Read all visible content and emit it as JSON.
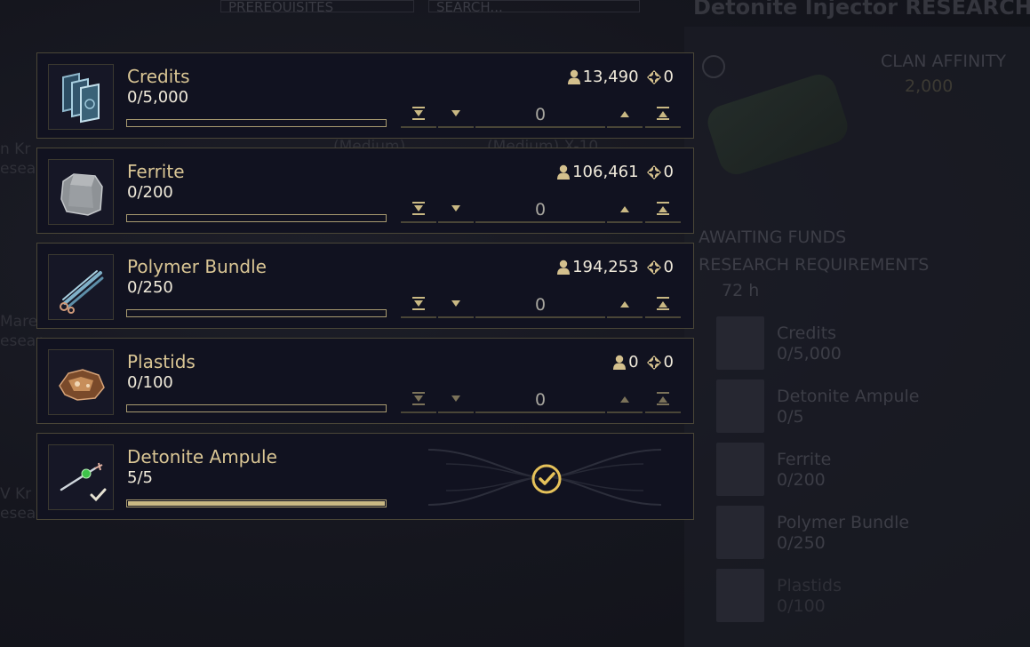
{
  "background": {
    "prereq_label": "PREREQUISITES",
    "search_label": "SEARCH...",
    "panel_title": "Detonite Injector RESEARCH",
    "clan_affinity_label": "CLAN AFFINITY",
    "clan_affinity_value": "2,000",
    "status": "AWAITING FUNDS",
    "requirements_label": "RESEARCH REQUIREMENTS",
    "duration": "72 h",
    "requirements": [
      {
        "name": "Credits",
        "count": "0/5,000"
      },
      {
        "name": "Detonite Ampule",
        "count": "0/5"
      },
      {
        "name": "Ferrite",
        "count": "0/200"
      },
      {
        "name": "Polymer Bundle",
        "count": "0/250"
      },
      {
        "name": "Plastids",
        "count": "0/100"
      }
    ],
    "left_fragments": [
      "n Kr",
      "esear",
      "Marel",
      "esear",
      "V Kr",
      "esear"
    ],
    "mid_fragments": [
      "(Medium)",
      "(Medium) X-10"
    ]
  },
  "contributions": [
    {
      "name": "Credits",
      "count": "0/5,000",
      "progress": 0,
      "player_owned": "13,490",
      "clan_owned": "0",
      "quantity": "0",
      "icon": "credits-icon"
    },
    {
      "name": "Ferrite",
      "count": "0/200",
      "progress": 0,
      "player_owned": "106,461",
      "clan_owned": "0",
      "quantity": "0",
      "icon": "ferrite-icon"
    },
    {
      "name": "Polymer Bundle",
      "count": "0/250",
      "progress": 0,
      "player_owned": "194,253",
      "clan_owned": "0",
      "quantity": "0",
      "icon": "polymer-bundle-icon"
    },
    {
      "name": "Plastids",
      "count": "0/100",
      "progress": 0,
      "player_owned": "0",
      "clan_owned": "0",
      "quantity": "0",
      "icon": "plastids-icon"
    },
    {
      "name": "Detonite Ampule",
      "count": "5/5",
      "progress": 1,
      "complete": true,
      "icon": "detonite-ampule-icon"
    }
  ],
  "colors": {
    "accent_gold": "#d9c594",
    "bar_fill": "#c9b883",
    "panel_bg": "#111220",
    "border": "#4a4637"
  }
}
